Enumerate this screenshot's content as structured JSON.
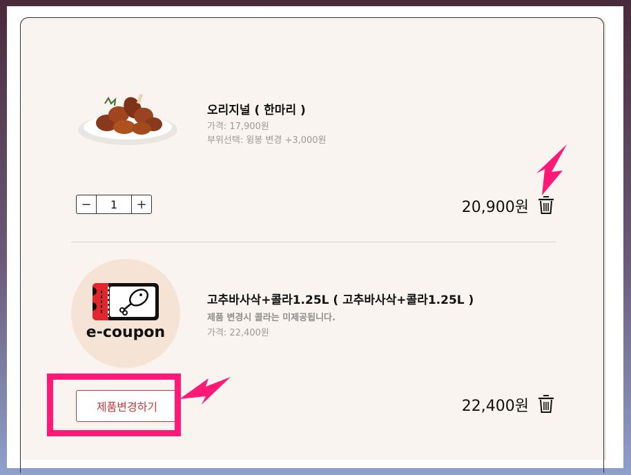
{
  "items": [
    {
      "name": "오리지널 ( 한마리 )",
      "details": [
        "가격: 17,900원",
        "부위선택: 윙봉 변경 +3,000원"
      ],
      "quantity": "1",
      "total": "20,900원",
      "image": "fried-chicken-plate"
    },
    {
      "name": "고추바사삭+콜라1.25L ( 고추바사삭+콜라1.25L )",
      "details": [
        "제품 변경시 콜라는 미제공됩니다.",
        "가격: 22,400원"
      ],
      "total": "22,400원",
      "image": "e-coupon",
      "coupon_text": "e-coupon",
      "change_button": "제품변경하기"
    }
  ],
  "controls": {
    "minus": "−",
    "plus": "+"
  },
  "colors": {
    "panel_bg": "#f9f4ef",
    "accent_red": "#c73a3a",
    "annotation_pink": "#ff1a78",
    "coupon_bg": "#f5e4d6"
  },
  "icons": [
    "trash-icon",
    "minus-icon",
    "plus-icon",
    "ticket-icon",
    "drumstick-icon",
    "arrow-annotation"
  ]
}
